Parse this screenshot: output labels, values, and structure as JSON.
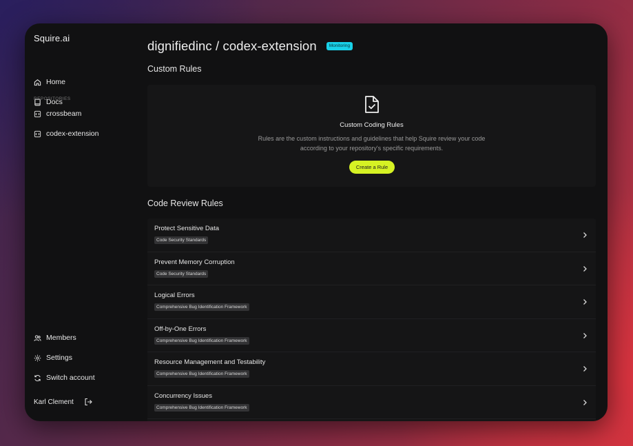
{
  "sidebar": {
    "brand": "Squire.ai",
    "nav": [
      {
        "label": "Home",
        "icon": "home-icon"
      },
      {
        "label": "Docs",
        "icon": "book-icon"
      }
    ],
    "repositories_label": "REPOSITORIES",
    "repositories": [
      {
        "label": "crossbeam",
        "icon": "repo-icon"
      },
      {
        "label": "codex-extension",
        "icon": "repo-icon"
      }
    ],
    "bottom_nav": [
      {
        "label": "Members",
        "icon": "users-icon"
      },
      {
        "label": "Settings",
        "icon": "gear-icon"
      },
      {
        "label": "Switch account",
        "icon": "refresh-icon"
      }
    ],
    "user_name": "Karl Clement"
  },
  "header": {
    "title": "dignifiedinc / codex-extension",
    "status_badge": "Monitoring"
  },
  "custom_rules": {
    "section_title": "Custom Rules",
    "empty_title": "Custom Coding Rules",
    "empty_description": "Rules are the custom instructions and guidelines that help Squire review your code according to your repository's specific requirements.",
    "create_button": "Create a Rule"
  },
  "code_review_rules": {
    "section_title": "Code Review Rules",
    "rules": [
      {
        "name": "Protect Sensitive Data",
        "tag": "Code Security Standards"
      },
      {
        "name": "Prevent Memory Corruption",
        "tag": "Code Security Standards"
      },
      {
        "name": "Logical Errors",
        "tag": "Comprehensive Bug Identification Framework"
      },
      {
        "name": "Off-by-One Errors",
        "tag": "Comprehensive Bug Identification Framework"
      },
      {
        "name": "Resource Management and Testability",
        "tag": "Comprehensive Bug Identification Framework"
      },
      {
        "name": "Concurrency Issues",
        "tag": "Comprehensive Bug Identification Framework"
      }
    ]
  },
  "colors": {
    "accent_lime": "#d6f224",
    "badge_cyan": "#19d1e8",
    "window_bg": "#111112"
  }
}
